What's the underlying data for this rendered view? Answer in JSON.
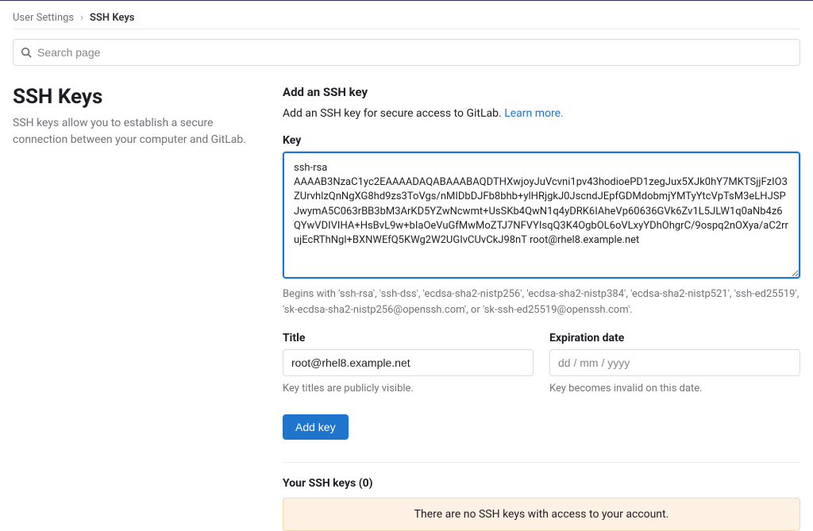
{
  "breadcrumb": {
    "parent": "User Settings",
    "current": "SSH Keys"
  },
  "search": {
    "placeholder": "Search page"
  },
  "page": {
    "title": "SSH Keys",
    "description": "SSH keys allow you to establish a secure connection between your computer and GitLab."
  },
  "add_section": {
    "title": "Add an SSH key",
    "description": "Add an SSH key for secure access to GitLab. ",
    "learn_more": "Learn more.",
    "key_label": "Key",
    "key_value": "ssh-rsa\nAAAAB3NzaC1yc2EAAAADAQABAAABAQDTHXwjoyJuVcvni1pv43hodioePD1zegJux5XJk0hY7MKTSjjFzIO3ZUrvhlzQnNgXG8hd9zs3ToVgs/nMIDbDJFb8bhb+ylHRjgkJ0JscndJEpfGDMdobmjYMTyYtcVpTsM3eLHJSPJwymA5C063rBB3bM3ArKD5YZwNcwmt+UsSKb4QwN1q4yDRK6IAheVp60636GVk6Zv1L5JLW1q0aNb4z6QYwVDIVIHA+HsBvL9w+bIaOeVuGfMwMoZTJ7NFVYIsqQ3K4OgbOL6oVLxyYDhOhgrC/9ospq2nOXya/aC2rrujEcRThNgl+BXNWEfQ5KWg2W2UGIvCUvCkJ98nT root@rhel8.example.net",
    "key_helper": "Begins with 'ssh-rsa', 'ssh-dss', 'ecdsa-sha2-nistp256', 'ecdsa-sha2-nistp384', 'ecdsa-sha2-nistp521', 'ssh-ed25519', 'sk-ecdsa-sha2-nistp256@openssh.com', or 'sk-ssh-ed25519@openssh.com'.",
    "title_label": "Title",
    "title_value": "root@rhel8.example.net",
    "title_helper": "Key titles are publicly visible.",
    "expiration_label": "Expiration date",
    "expiration_placeholder": "dd / mm / yyyy",
    "expiration_helper": "Key becomes invalid on this date.",
    "submit_label": "Add key"
  },
  "your_keys": {
    "heading": "Your SSH keys (0)",
    "empty_message": "There are no SSH keys with access to your account."
  }
}
